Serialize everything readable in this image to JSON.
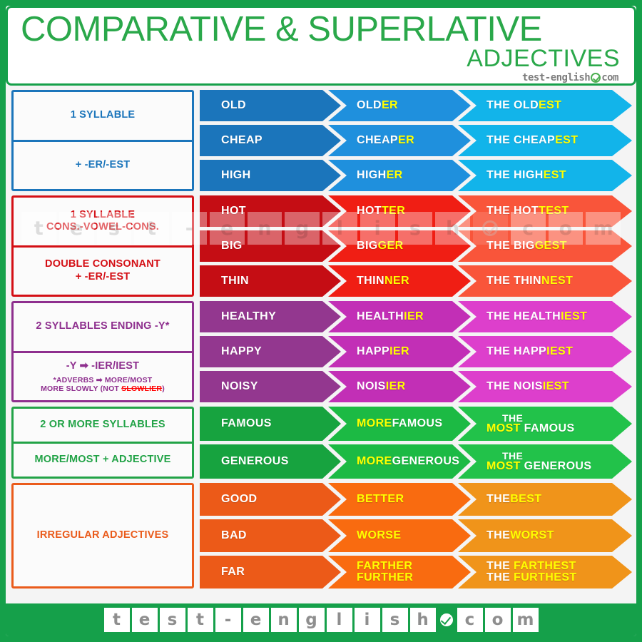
{
  "header": {
    "title_main": "COMPARATIVE & SUPERLATIVE",
    "title_sub": "ADJECTIVES",
    "logo_left": "test-english",
    "logo_right": "com",
    "check_icon": "check-circle-icon"
  },
  "colors": {
    "brand_green": "#15a04a",
    "blue": "#1b75bb",
    "red": "#d40f15",
    "purple": "#8e2f8e",
    "green": "#22a347",
    "orange": "#ea5b1b",
    "highlight": "#ffff00"
  },
  "sections": [
    {
      "id": "one-syllable",
      "hue": "blue",
      "labels": [
        {
          "lines": [
            "1 SYLLABLE"
          ]
        },
        {
          "lines": [
            "+ -ER/-EST"
          ]
        }
      ],
      "rows": [
        {
          "base": "OLD",
          "comp_stem": "OLD",
          "comp_suffix": "ER",
          "sup_stem": "THE OLD",
          "sup_suffix": "EST"
        },
        {
          "base": "CHEAP",
          "comp_stem": "CHEAP",
          "comp_suffix": "ER",
          "sup_stem": "THE CHEAP",
          "sup_suffix": "EST"
        },
        {
          "base": "HIGH",
          "comp_stem": "HIGH",
          "comp_suffix": "ER",
          "sup_stem": "THE HIGH",
          "sup_suffix": "EST"
        }
      ]
    },
    {
      "id": "cons-vowel-cons",
      "hue": "red",
      "labels": [
        {
          "lines": [
            "1 SYLLABLE",
            "CONS.-VOWEL-CONS."
          ]
        },
        {
          "lines": [
            "DOUBLE CONSONANT",
            "+ -ER/-EST"
          ]
        }
      ],
      "rows": [
        {
          "base": "HOT",
          "comp_stem": "HOT",
          "comp_suffix": "TER",
          "sup_stem": "THE HOT",
          "sup_suffix": "TEST"
        },
        {
          "base": "BIG",
          "comp_stem": "BIG",
          "comp_suffix": "GER",
          "sup_stem": "THE BIG",
          "sup_suffix": "GEST"
        },
        {
          "base": "THIN",
          "comp_stem": "THIN",
          "comp_suffix": "NER",
          "sup_stem": "THE THIN",
          "sup_suffix": "NEST"
        }
      ]
    },
    {
      "id": "two-syllables-y",
      "hue": "purple",
      "labels": [
        {
          "lines": [
            "2 SYLLABLES ENDING -Y*"
          ]
        },
        {
          "lines": [
            "-Y ➡ -IER/IEST"
          ],
          "note_line1_pre": "*ADVERBS ➡ MORE/MOST",
          "note_line2_pre": "MORE SLOWLY (NOT ",
          "note_line2_strike": "SLOWLIER",
          "note_line2_post": ")"
        }
      ],
      "rows": [
        {
          "base": "HEALTHY",
          "comp_stem": "HEALTH",
          "comp_suffix": "IER",
          "sup_stem": "THE HEALTH",
          "sup_suffix": "IEST"
        },
        {
          "base": "HAPPY",
          "comp_stem": "HAPP",
          "comp_suffix": "IER",
          "sup_stem": "THE HAPP",
          "sup_suffix": "IEST"
        },
        {
          "base": "NOISY",
          "comp_stem": "NOIS",
          "comp_suffix": "IER",
          "sup_stem": "THE NOIS",
          "sup_suffix": "IEST"
        }
      ]
    },
    {
      "id": "more-most",
      "hue": "green",
      "labels": [
        {
          "lines": [
            "2 OR MORE SYLLABLES"
          ]
        },
        {
          "lines": [
            "MORE/MOST + ADJECTIVE"
          ]
        }
      ],
      "rows": [
        {
          "base": "FAMOUS",
          "comp_prefix": "MORE",
          "comp_word": "FAMOUS",
          "sup_the": "THE",
          "sup_prefix": "MOST",
          "sup_word": "FAMOUS"
        },
        {
          "base": "GENEROUS",
          "comp_prefix": "MORE",
          "comp_word": "GENEROUS",
          "sup_the": "THE",
          "sup_prefix": "MOST",
          "sup_word": "GENEROUS"
        }
      ]
    },
    {
      "id": "irregular",
      "hue": "orange",
      "labels": [
        {
          "lines": [
            "IRREGULAR ADJECTIVES"
          ]
        }
      ],
      "rows": [
        {
          "base": "GOOD",
          "comp_hl": "BETTER",
          "sup_the": "THE ",
          "sup_hl": "BEST"
        },
        {
          "base": "BAD",
          "comp_hl": "WORSE",
          "sup_the": "THE ",
          "sup_hl": "WORST"
        },
        {
          "base": "FAR",
          "comp_hl": "FARTHER",
          "comp_hl2": "FURTHER",
          "sup_the": "THE ",
          "sup_hl": "FARTHEST",
          "sup_the2": "THE ",
          "sup_hl2": "FURTHEST"
        }
      ]
    }
  ],
  "watermark": {
    "letters": [
      "t",
      "e",
      "s",
      "t",
      "-",
      "e",
      "n",
      "g",
      "l",
      "i",
      "s",
      "h"
    ],
    "suffix": [
      "c",
      "o",
      "m"
    ],
    "check_icon": "check-circle-icon"
  },
  "footer": {
    "letters": [
      "t",
      "e",
      "s",
      "t",
      "-",
      "e",
      "n",
      "g",
      "l",
      "i",
      "s",
      "h"
    ],
    "suffix": [
      "c",
      "o",
      "m"
    ],
    "check_icon": "check-circle-icon"
  }
}
